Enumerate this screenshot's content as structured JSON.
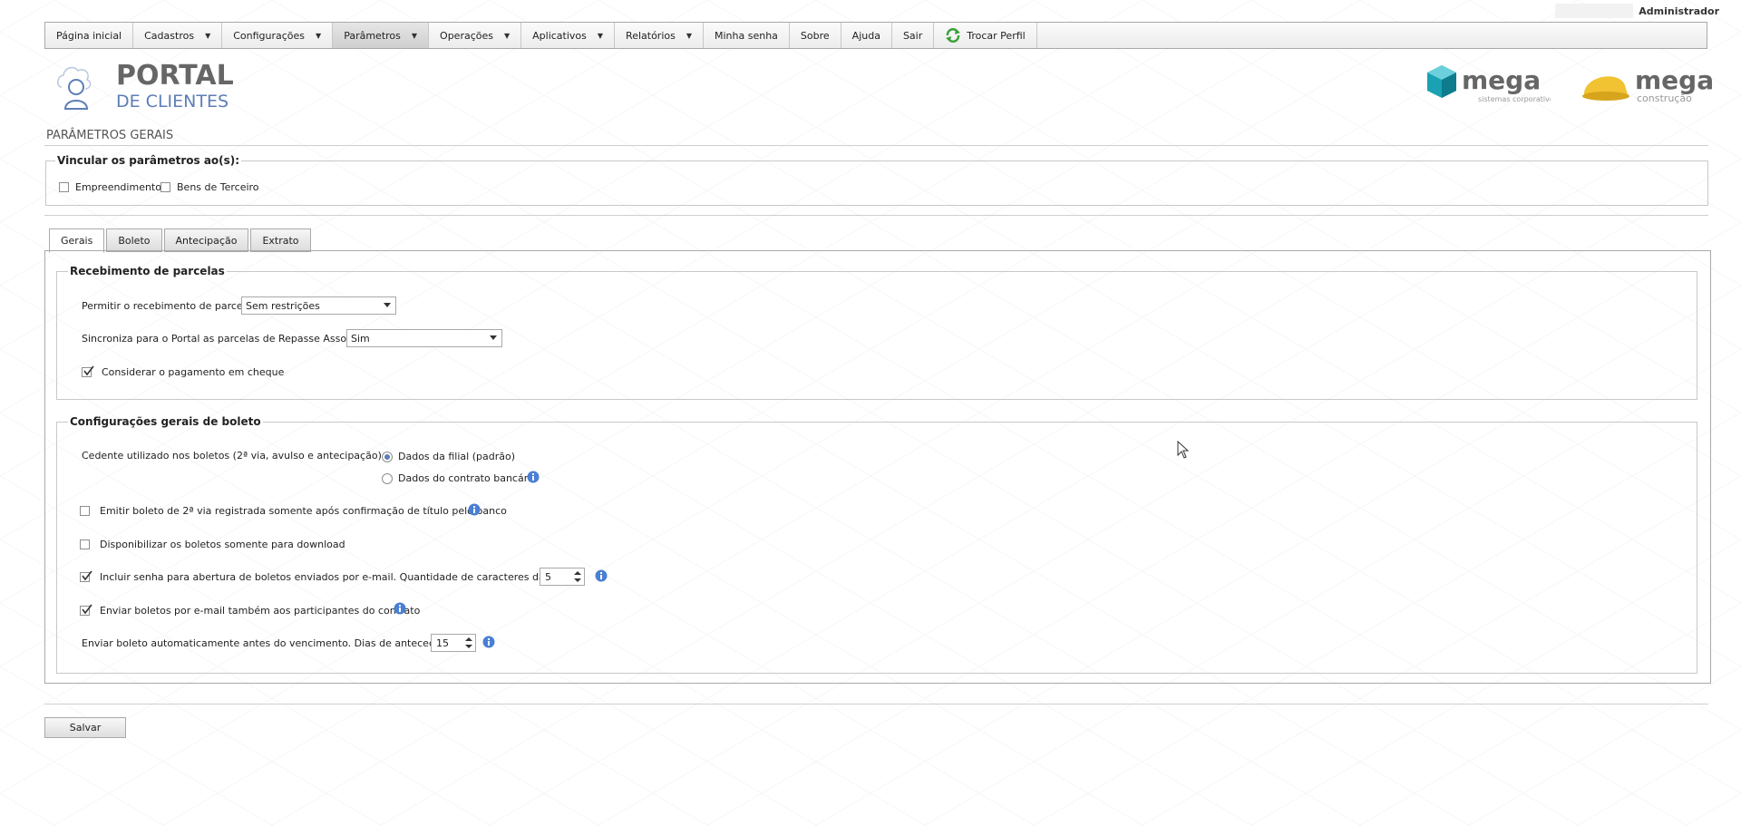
{
  "user": {
    "name": "Administrador"
  },
  "menu": {
    "items": [
      {
        "label": "Página inicial",
        "dropdown": false
      },
      {
        "label": "Cadastros",
        "dropdown": true
      },
      {
        "label": "Configurações",
        "dropdown": true
      },
      {
        "label": "Parâmetros",
        "dropdown": true,
        "active": true
      },
      {
        "label": "Operações",
        "dropdown": true
      },
      {
        "label": "Aplicativos",
        "dropdown": true
      },
      {
        "label": "Relatórios",
        "dropdown": true
      },
      {
        "label": "Minha senha",
        "dropdown": false
      },
      {
        "label": "Sobre",
        "dropdown": false
      },
      {
        "label": "Ajuda",
        "dropdown": false
      },
      {
        "label": "Sair",
        "dropdown": false
      },
      {
        "label": "Trocar Perfil",
        "dropdown": false,
        "icon": "swap-profile-icon"
      }
    ]
  },
  "logos": {
    "portal": {
      "line1": "PORTAL",
      "line2": "DE CLIENTES"
    },
    "mega1": {
      "name": "mega",
      "tagline": "sistemas corporativos"
    },
    "mega2": {
      "name": "mega",
      "tagline": "construção"
    }
  },
  "page": {
    "title": "PARÂMETROS GERAIS"
  },
  "vincular": {
    "legend": "Vincular os parâmetros ao(s):",
    "options": [
      {
        "label": "Empreendimento",
        "checked": false
      },
      {
        "label": "Bens de Terceiro",
        "checked": false
      }
    ]
  },
  "tabs": [
    "Gerais",
    "Boleto",
    "Antecipação",
    "Extrato"
  ],
  "recebimento": {
    "legend": "Recebimento de parcelas",
    "permitir_label": "Permitir o recebimento de parcelas",
    "permitir_value": "Sem restrições",
    "sincroniza_label": "Sincroniza para o Portal as parcelas de Repasse Associativo",
    "sincroniza_value": "Sim",
    "cheque_label": "Considerar o pagamento em cheque",
    "cheque_checked": true
  },
  "boleto": {
    "legend": "Configurações gerais de boleto",
    "cedente_label": "Cedente utilizado nos boletos (2ª via, avulso e antecipação)",
    "cedente_options": [
      "Dados da filial (padrão)",
      "Dados do contrato bancário"
    ],
    "emitir_label": "Emitir boleto de 2ª via registrada somente após confirmação de título pelo banco",
    "download_label": "Disponibilizar os boletos somente para download",
    "senha_label": "Incluir senha para abertura de boletos enviados por e-mail. Quantidade de caracteres da senha:",
    "senha_value": "5",
    "participantes_label": "Enviar boletos por e-mail também aos participantes do contrato",
    "automatico_label": "Enviar boleto automaticamente antes do vencimento. Dias de antecedência",
    "automatico_value": "15"
  },
  "actions": {
    "save_label": "Salvar"
  },
  "colors": {
    "accent": "#5d7eb6",
    "info": "#4a7fd4",
    "mega_teal": "#1aa1b4",
    "mega_yellow": "#f1c232"
  }
}
